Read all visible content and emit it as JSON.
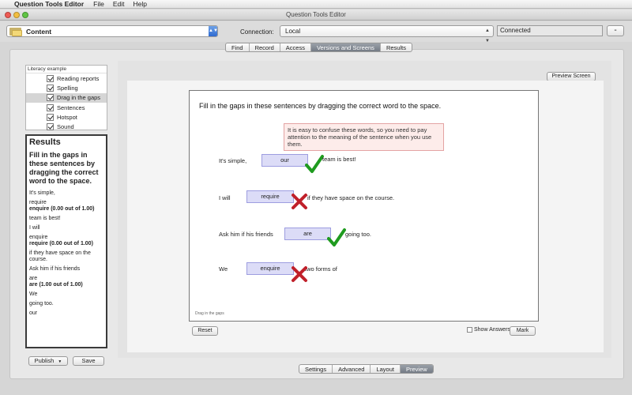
{
  "menubar": {
    "app_name": "Question Tools Editor",
    "items": [
      "File",
      "Edit",
      "Help"
    ]
  },
  "window": {
    "title": "Question Tools Editor"
  },
  "toolbar": {
    "content_label": "Content",
    "connection_label": "Connection:",
    "connection_value": "Local",
    "connection_status": "Connected",
    "minus_label": "-"
  },
  "top_tabs": [
    "Find",
    "Record",
    "Access",
    "Versions and Screens",
    "Results"
  ],
  "top_tabs_active": "Versions and Screens",
  "tree": {
    "root": "Literacy example",
    "items": [
      {
        "label": "Reading reports",
        "checked": true
      },
      {
        "label": "Spelling",
        "checked": true
      },
      {
        "label": "Drag in the gaps",
        "checked": true,
        "selected": true
      },
      {
        "label": "Sentences",
        "checked": true
      },
      {
        "label": "Hotspot",
        "checked": true
      },
      {
        "label": "Sound",
        "checked": true
      }
    ]
  },
  "results": {
    "title": "Results",
    "question": "Fill in the gaps in these sentences by dragging the correct word to the space.",
    "lines": [
      {
        "text": "It's simple,",
        "bold": false
      },
      {
        "text": "require",
        "bold": false
      },
      {
        "text": "enquire (0.00 out of 1.00)",
        "bold": true
      },
      {
        "text": "team is best!",
        "bold": false
      },
      {
        "text": "I will",
        "bold": false
      },
      {
        "text": "enquire",
        "bold": false
      },
      {
        "text": "require (0.00 out of 1.00)",
        "bold": true
      },
      {
        "text": "if they have space on the course.",
        "bold": false
      },
      {
        "text": "Ask him if his friends",
        "bold": false
      },
      {
        "text": "are",
        "bold": false
      },
      {
        "text": "are (1.00 out of 1.00)",
        "bold": true
      },
      {
        "text": "We",
        "bold": false
      },
      {
        "text": "going too.",
        "bold": false
      },
      {
        "text": "our",
        "bold": false
      }
    ]
  },
  "left_buttons": {
    "publish": "Publish",
    "save": "Save"
  },
  "preview": {
    "preview_screen_button": "Preview Screen",
    "instruction": "Fill in the gaps in these sentences by dragging the correct word to the space.",
    "hint": "It is easy to confuse these words, so you need to pay attention to the meaning of the sentence when you use them.",
    "sentences": [
      {
        "before": "It's simple,",
        "answer": "our",
        "after": "team is best!",
        "correct": true
      },
      {
        "before": "I will",
        "answer": "require",
        "after": "if they have space on the course.",
        "correct": false
      },
      {
        "before": "Ask him if his friends",
        "answer": "are",
        "after": "going too.",
        "correct": true
      },
      {
        "before": "We",
        "answer": "enquire",
        "after": "two forms of",
        "correct": false
      }
    ],
    "footer": "Drag in the gaps",
    "reset_button": "Reset",
    "show_answers_label": "Show Answers",
    "mark_button": "Mark"
  },
  "bottom_tabs": [
    "Settings",
    "Advanced",
    "Layout",
    "Preview"
  ],
  "bottom_tabs_active": "Preview",
  "colors": {
    "correct": "#1f9b1f",
    "incorrect": "#c0202a",
    "drop_fill": "#dcdcf7",
    "hint_fill": "#fdecea"
  },
  "icons": {
    "apple": "apple-logo-icon",
    "folder": "folder-icon",
    "check": "check-icon",
    "cross": "cross-icon"
  }
}
